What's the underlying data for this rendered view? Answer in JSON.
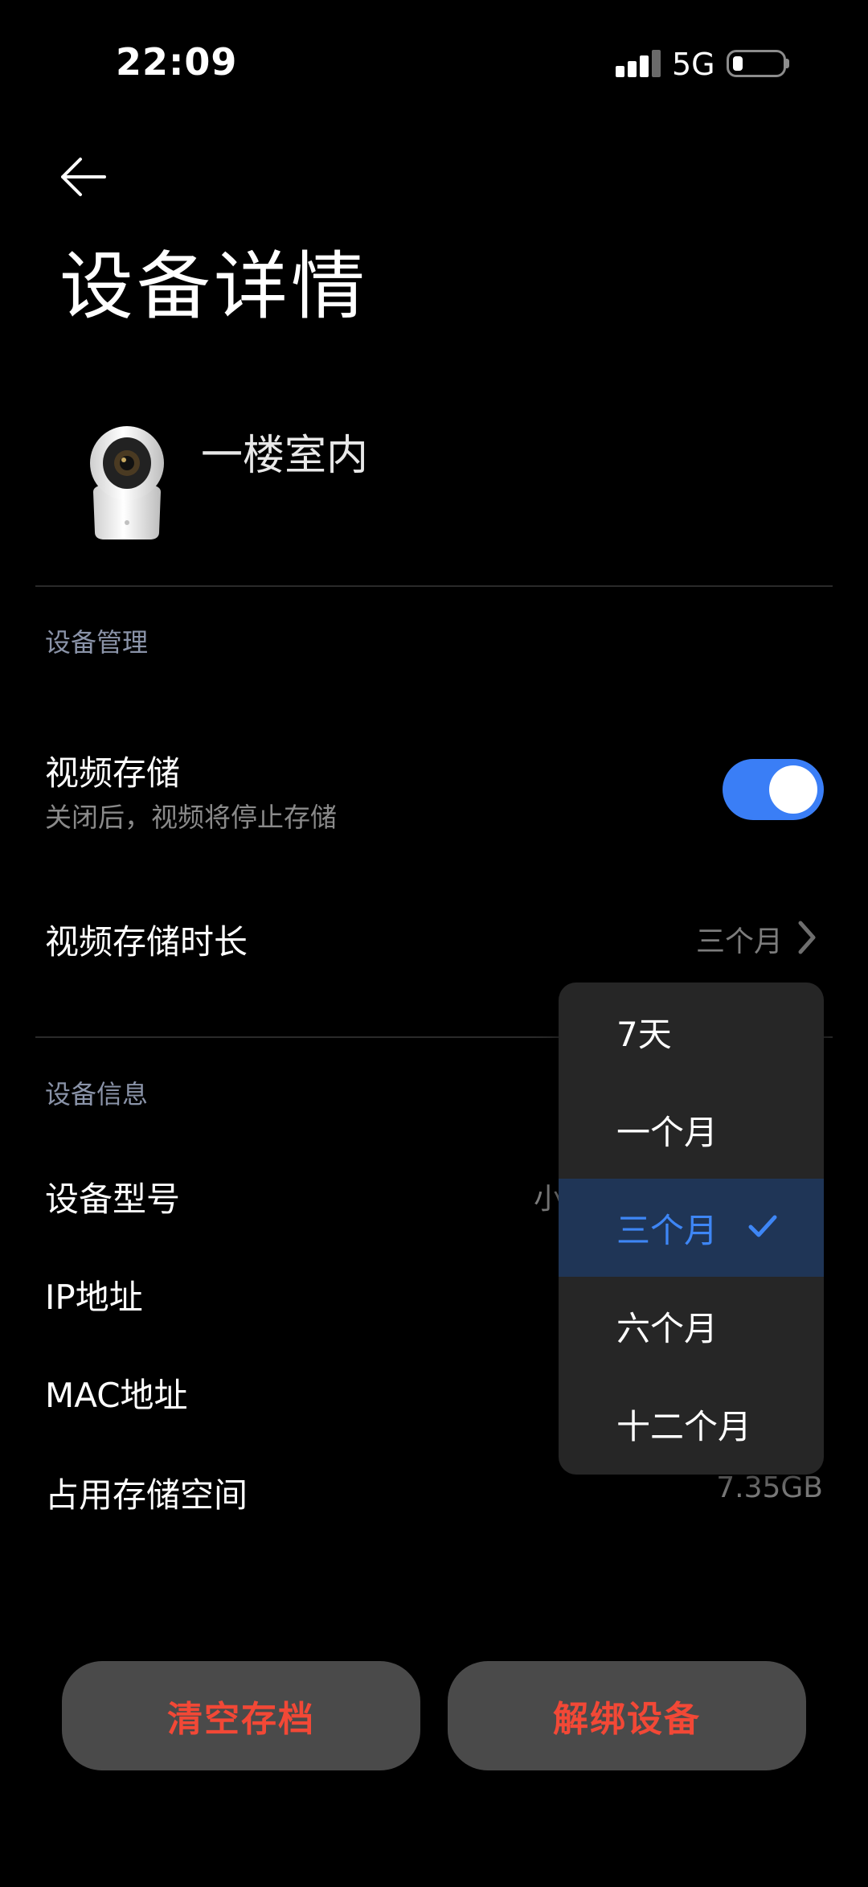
{
  "status_bar": {
    "time": "22:09",
    "network": "5G",
    "signal_bars_active": 3,
    "signal_bars_total": 4,
    "battery_level": 0.2
  },
  "header": {
    "back_icon": "arrow-left-icon",
    "title": "设备详情"
  },
  "device": {
    "name": "一楼室内",
    "image_icon": "security-camera-icon"
  },
  "sections": {
    "management_label": "设备管理",
    "info_label": "设备信息"
  },
  "video_storage": {
    "title": "视频存储",
    "subtitle": "关闭后，视频将停止存储",
    "enabled": true
  },
  "storage_duration": {
    "title": "视频存储时长",
    "value": "三个月"
  },
  "device_info": {
    "model_label": "设备型号",
    "model_value_partial": "小",
    "ip_label": "IP地址",
    "mac_label": "MAC地址",
    "storage_label": "占用存储空间",
    "storage_value": "7.35GB"
  },
  "dropdown": {
    "options": [
      "7天",
      "一个月",
      "三个月",
      "六个月",
      "十二个月"
    ],
    "selected_index": 2
  },
  "buttons": {
    "clear_label": "清空存档",
    "unbind_label": "解绑设备"
  },
  "colors": {
    "accent": "#3a7ef6",
    "danger": "#f24836",
    "background": "#000000",
    "button_bg": "#4a4a4a",
    "dropdown_bg": "#262626",
    "selected_bg": "#1f3556"
  }
}
